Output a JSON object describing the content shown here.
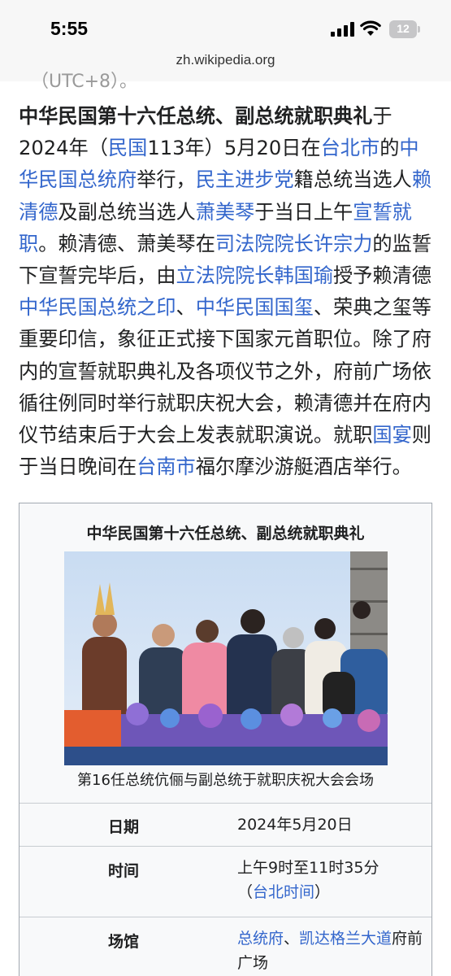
{
  "status_bar": {
    "time": "5:55",
    "battery": "12"
  },
  "browser": {
    "url": "zh.wikipedia.org"
  },
  "clipped_text": "（UTC+8）。",
  "article": {
    "title_bold": "中华民国第十六任总统、副总统就职典礼",
    "t1": "于2024年（",
    "l_minguo": "民国",
    "t2": "113年）5月20日在",
    "l_taipei": "台北市",
    "t3": "的",
    "l_office": "中华民国总统府",
    "t4": "举行，",
    "l_dpp": "民主进步党",
    "t5": "籍总统当选人",
    "l_lai": "赖清德",
    "t6": "及副总统当选人",
    "l_hsiao": "萧美琴",
    "t7": "于当日上午",
    "l_oath": "宣誓就职",
    "t8": "。赖清德、萧美琴在",
    "l_judicial": "司法院院长许宗力",
    "t9": "的监誓下宣誓完毕后，由",
    "l_legislative": "立法院院长韩国瑜",
    "t10": "授予赖清德",
    "l_seal1": "中华民国总统之印",
    "t11": "、",
    "l_seal2": "中华民国国玺",
    "t12": "、荣典之玺等重要印信，象征正式接下国家元首职位。除了府内的宣誓就职典礼及各项仪节之外，府前广场依循往例同时举行就职庆祝大会，赖清德并在府内仪节结束后于大会上发表就职演说。就职",
    "l_banquet": "国宴",
    "t13": "则于当日晚间在",
    "l_tainan": "台南市",
    "t14": "福尔摩沙游艇酒店举行。"
  },
  "infobox": {
    "title": "中华民国第十六任总统、副总统就职典礼",
    "caption": "第16任总统伉俪与副总统于就职庆祝大会会场",
    "date_label": "日期",
    "date_value": "2024年5月20日",
    "time_label": "时间",
    "time_value": "上午9时至11时35分",
    "time_zone_open": "（",
    "time_zone_link": "台北时间",
    "time_zone_close": "）",
    "venue_label": "场馆",
    "venue_link1": "总统府",
    "venue_sep": "、",
    "venue_link2": "凯达格兰大道",
    "venue_rest": "府前广场"
  },
  "colors": {
    "link": "#3366cc",
    "text": "#202122",
    "infobox_bg": "#f8f9fa",
    "border": "#a2a9b1"
  }
}
